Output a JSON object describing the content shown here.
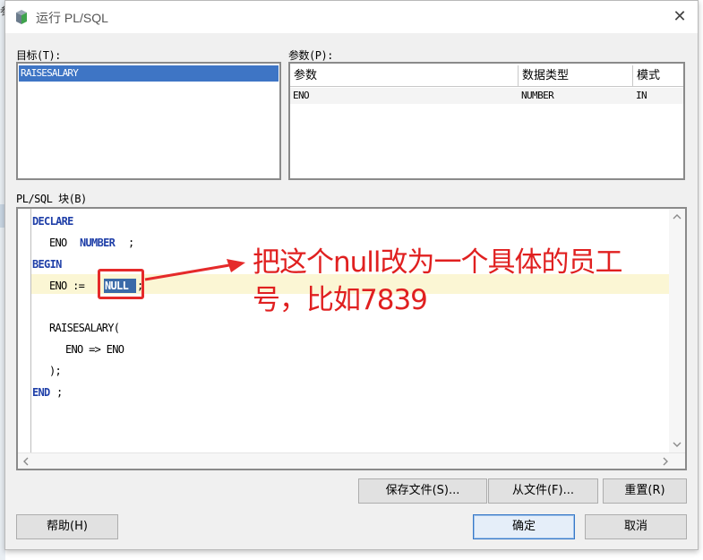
{
  "window": {
    "title": "运行 PL/SQL",
    "close_glyph": "✕"
  },
  "background": {
    "edge_char": "参"
  },
  "target_section": {
    "label": "目标(T):",
    "items": [
      "RAISESALARY"
    ]
  },
  "params_section": {
    "label": "参数(P):",
    "headers": [
      "参数",
      "数据类型",
      "模式"
    ],
    "rows": [
      [
        "ENO",
        "NUMBER",
        "IN"
      ]
    ]
  },
  "block_section": {
    "label": "PL/SQL 块(B)",
    "code": {
      "line1": "DECLARE",
      "line2_ident": "ENO ",
      "line2_type": "NUMBER",
      "line2_end": ";",
      "line3": "BEGIN",
      "line4_prefix": "ENO := ",
      "line4_selected": "NULL",
      "line4_end": ";",
      "line6": "RAISESALARY(",
      "line7": "ENO => ENO",
      "line8": ");",
      "line9_kw": "END",
      "line9_end": ";"
    }
  },
  "buttons": {
    "save_file": "保存文件(S)...",
    "from_file": "从文件(F)...",
    "reset": "重置(R)",
    "help": "帮助(H)",
    "ok": "确定",
    "cancel": "取消"
  },
  "annotation": {
    "text": "把这个null改为一个具体的员工号，比如7839",
    "color": "#e02020"
  },
  "colors": {
    "selection": "#3e75c5",
    "keyword": "#1f3fa8",
    "current_line": "#fbf6d4"
  },
  "icons": {
    "title": "plsql-run-icon",
    "close": "close-icon",
    "scroll_up": "chevron-up-icon",
    "scroll_down": "chevron-down-icon",
    "scroll_left": "chevron-left-icon",
    "scroll_right": "chevron-right-icon"
  }
}
